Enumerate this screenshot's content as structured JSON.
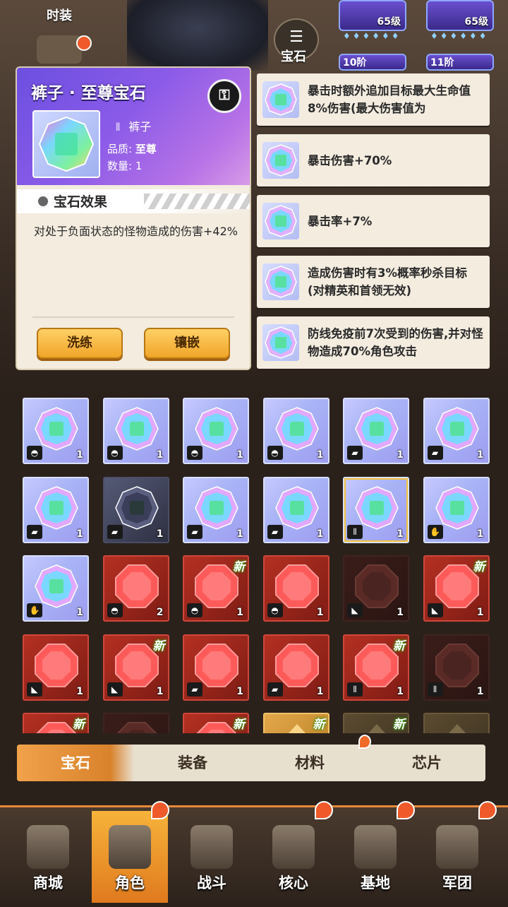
{
  "top": {
    "costume_label": "时装",
    "gem_label": "宝石",
    "items": [
      {
        "level": "65级",
        "stage": "10阶"
      },
      {
        "level": "65级",
        "stage": "11阶"
      }
    ]
  },
  "detail": {
    "title": "裤子 · 至尊宝石",
    "lock_icon": "lock-icon",
    "slot_name": "裤子",
    "quality_label": "品质:",
    "quality_value": "至尊",
    "quantity_label": "数量:",
    "quantity_value": "1",
    "effect_title": "宝石效果",
    "effect_text": "对处于负面状态的怪物造成的伤害+42%",
    "refine_button": "洗练",
    "inlay_button": "镶嵌"
  },
  "skills": [
    {
      "text": "暴击时额外追加目标最大生命值8%伤害(最大伤害值为"
    },
    {
      "text": "暴击伤害+70%"
    },
    {
      "text": "暴击率+7%"
    },
    {
      "text": "造成伤害时有3%概率秒杀目标(对精英和首领无效)"
    },
    {
      "text": "防线免疫前7次受到的伤害,并对怪物造成70%角色攻击"
    }
  ],
  "new_label": "新",
  "gems": [
    [
      {
        "style": "rainbow",
        "slot": "helmet-icon",
        "count": "1",
        "new": false
      },
      {
        "style": "rainbow",
        "slot": "helmet-icon",
        "count": "1",
        "new": false
      },
      {
        "style": "rainbow",
        "slot": "helmet-icon",
        "count": "1",
        "new": false
      },
      {
        "style": "rainbow",
        "slot": "helmet-icon",
        "count": "1",
        "new": false
      },
      {
        "style": "rainbow",
        "slot": "armor-icon",
        "count": "1",
        "new": false
      },
      {
        "style": "rainbow",
        "slot": "armor-icon",
        "count": "1",
        "new": false
      }
    ],
    [
      {
        "style": "rainbow",
        "slot": "armor-icon",
        "count": "1",
        "new": false
      },
      {
        "style": "dim",
        "slot": "armor-icon",
        "count": "1",
        "new": false
      },
      {
        "style": "rainbow",
        "slot": "armor-icon",
        "count": "1",
        "new": false
      },
      {
        "style": "rainbow",
        "slot": "armor-icon",
        "count": "1",
        "new": false
      },
      {
        "style": "rainbow-sel",
        "slot": "pants-icon",
        "count": "1",
        "new": false
      },
      {
        "style": "rainbow",
        "slot": "glove-icon",
        "count": "1",
        "new": false
      }
    ],
    [
      {
        "style": "rainbow",
        "slot": "glove-icon",
        "count": "1",
        "new": false
      },
      {
        "style": "red",
        "slot": "helmet-icon",
        "count": "2",
        "new": false
      },
      {
        "style": "red",
        "slot": "helmet-icon",
        "count": "1",
        "new": true
      },
      {
        "style": "red",
        "slot": "helmet-icon",
        "count": "1",
        "new": false
      },
      {
        "style": "dimred",
        "slot": "boot-icon",
        "count": "1",
        "new": false
      },
      {
        "style": "red",
        "slot": "boot-icon",
        "count": "1",
        "new": true
      }
    ],
    [
      {
        "style": "red",
        "slot": "boot-icon",
        "count": "1",
        "new": false
      },
      {
        "style": "red",
        "slot": "boot-icon",
        "count": "1",
        "new": true
      },
      {
        "style": "red",
        "slot": "armor-icon",
        "count": "1",
        "new": false
      },
      {
        "style": "red",
        "slot": "armor-icon",
        "count": "1",
        "new": false
      },
      {
        "style": "red",
        "slot": "pants-icon",
        "count": "1",
        "new": true
      },
      {
        "style": "dimred",
        "slot": "pants-icon",
        "count": "1",
        "new": false
      }
    ],
    [
      {
        "style": "red",
        "slot": "",
        "count": "",
        "new": true
      },
      {
        "style": "dimred",
        "slot": "",
        "count": "",
        "new": false
      },
      {
        "style": "red",
        "slot": "",
        "count": "",
        "new": true
      },
      {
        "style": "gold",
        "slot": "",
        "count": "",
        "new": true
      },
      {
        "style": "dimgold",
        "slot": "",
        "count": "",
        "new": true
      },
      {
        "style": "dimgold",
        "slot": "",
        "count": "",
        "new": false
      }
    ]
  ],
  "tabs": [
    {
      "label": "宝石",
      "active": true
    },
    {
      "label": "装备",
      "active": false
    },
    {
      "label": "材料",
      "active": false
    },
    {
      "label": "芯片",
      "active": false
    }
  ],
  "nav": [
    {
      "label": "商城",
      "icon": "shop-icon",
      "active": false,
      "alert": false
    },
    {
      "label": "角色",
      "icon": "character-icon",
      "active": true,
      "alert": true
    },
    {
      "label": "战斗",
      "icon": "battle-icon",
      "active": false,
      "alert": false
    },
    {
      "label": "核心",
      "icon": "core-icon",
      "active": false,
      "alert": true
    },
    {
      "label": "基地",
      "icon": "base-icon",
      "active": false,
      "alert": true
    },
    {
      "label": "军团",
      "icon": "legion-icon",
      "active": false,
      "alert": true
    }
  ],
  "colors": {
    "accent": "#f0a528",
    "purple_header": "#8b5be8",
    "new_glow": "#3b9a10",
    "red_gem": "#b43022"
  }
}
